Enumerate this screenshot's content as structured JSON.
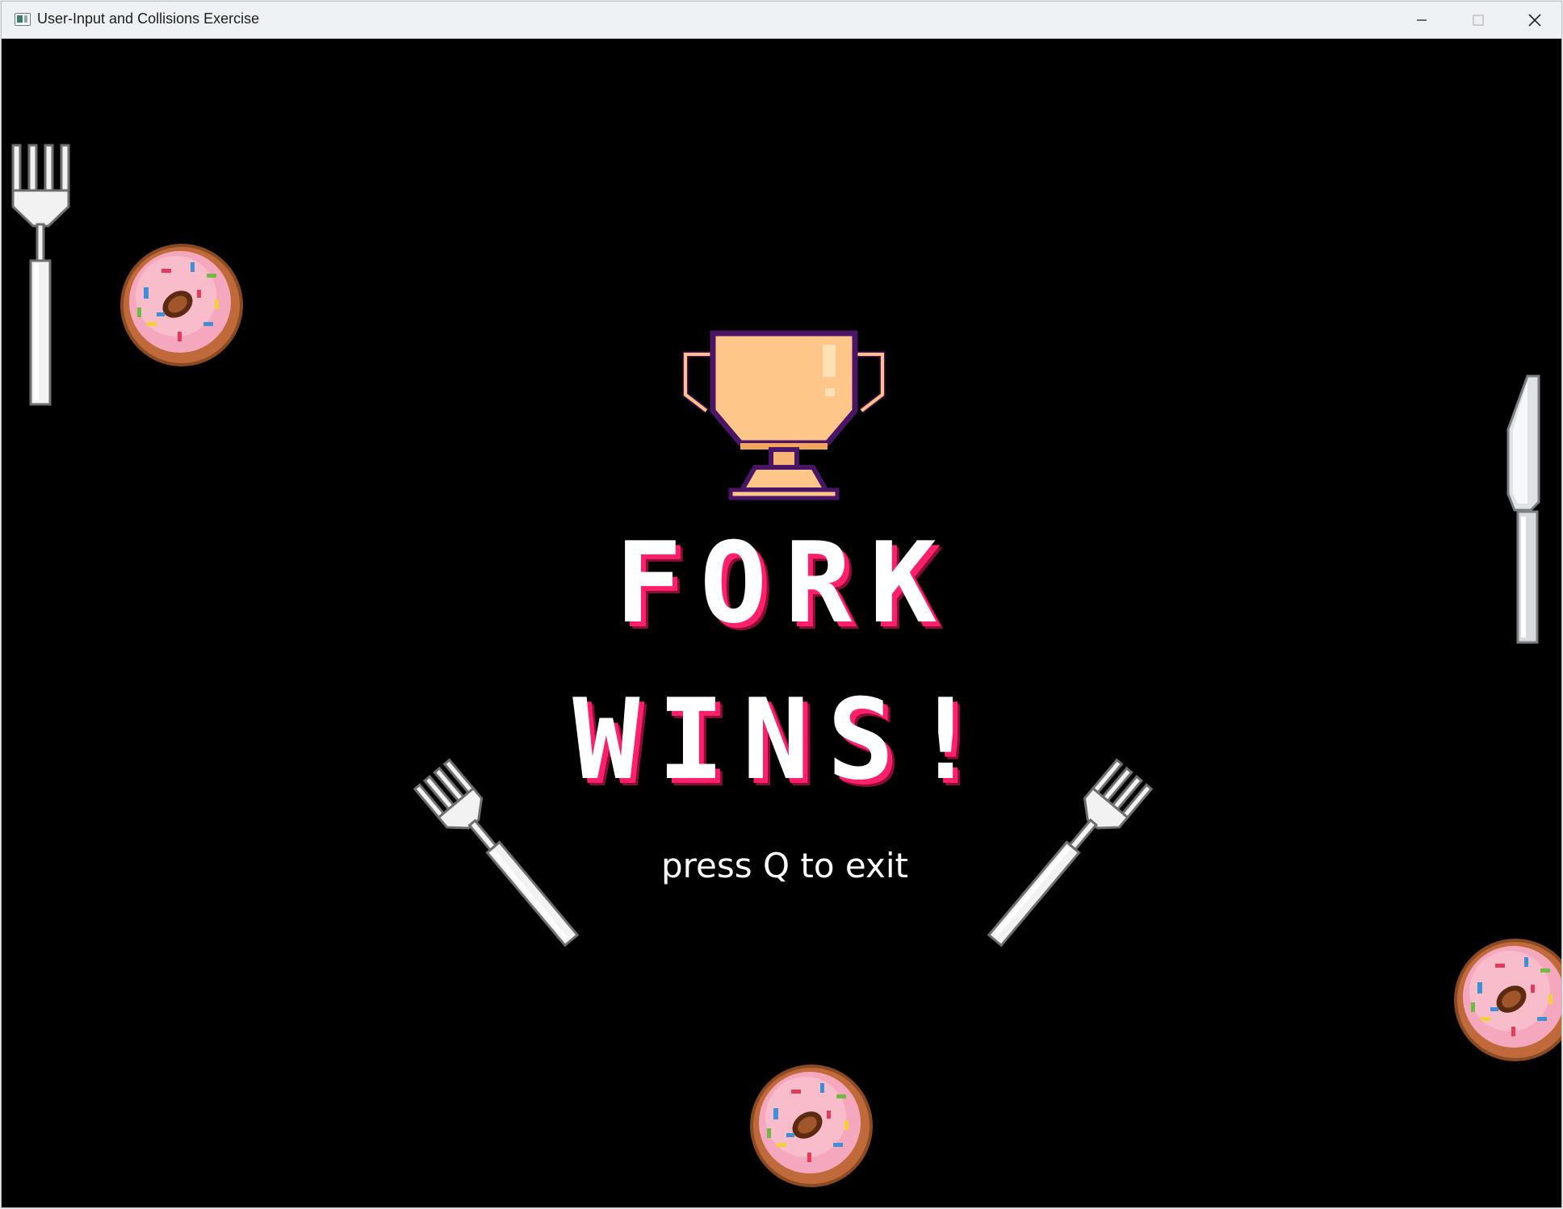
{
  "window": {
    "title": "User-Input and Collisions Exercise",
    "controls": [
      "minimize-icon",
      "maximize-icon",
      "close-icon"
    ]
  },
  "game": {
    "background": "#000000",
    "banner": {
      "line1": "FORK",
      "line2": "WINS!",
      "text_color": "#ffffff",
      "shadow_color": "#ff1f6b"
    },
    "hint": "press Q to exit",
    "sprites": [
      "trophy-icon",
      "fork-icon",
      "knife-icon",
      "donut-icon"
    ]
  }
}
